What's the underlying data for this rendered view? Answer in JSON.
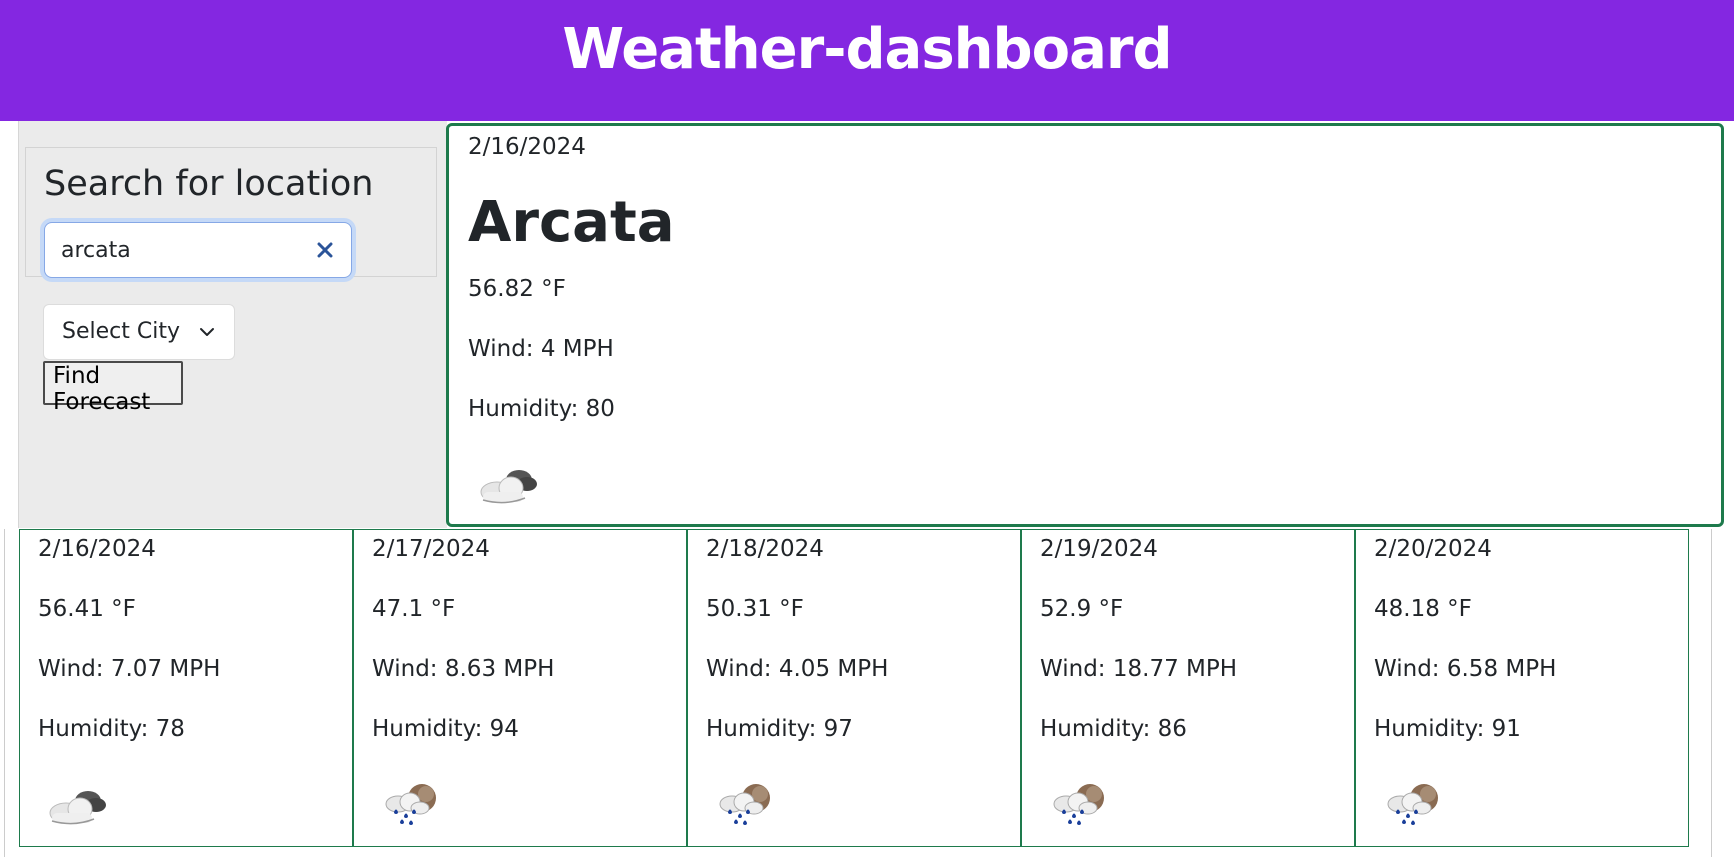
{
  "header": {
    "title": "Weather-dashboard"
  },
  "search": {
    "title": "Search for location",
    "value": "arcata",
    "select_label": "Select City",
    "button_label": "Find Forecast"
  },
  "current": {
    "date": "2/16/2024",
    "city": "Arcata",
    "temp": "56.82 °F",
    "wind": "Wind: 4 MPH",
    "humidity": "Humidity: 80",
    "icon": "cloudy-icon"
  },
  "forecast": [
    {
      "date": "2/16/2024",
      "temp": "56.41 °F",
      "wind": "Wind: 7.07 MPH",
      "humidity": "Humidity: 78",
      "icon": "cloudy-icon"
    },
    {
      "date": "2/17/2024",
      "temp": "47.1 °F",
      "wind": "Wind: 8.63 MPH",
      "humidity": "Humidity: 94",
      "icon": "rain-icon"
    },
    {
      "date": "2/18/2024",
      "temp": "50.31 °F",
      "wind": "Wind: 4.05 MPH",
      "humidity": "Humidity: 97",
      "icon": "rain-icon"
    },
    {
      "date": "2/19/2024",
      "temp": "52.9 °F",
      "wind": "Wind: 18.77 MPH",
      "humidity": "Humidity: 86",
      "icon": "rain-icon"
    },
    {
      "date": "2/20/2024",
      "temp": "48.18 °F",
      "wind": "Wind: 6.58 MPH",
      "humidity": "Humidity: 91",
      "icon": "rain-icon"
    }
  ],
  "colors": {
    "header_bg": "#8427e1",
    "card_border": "#1e7a4c",
    "sidebar_bg": "#ebebeb"
  }
}
